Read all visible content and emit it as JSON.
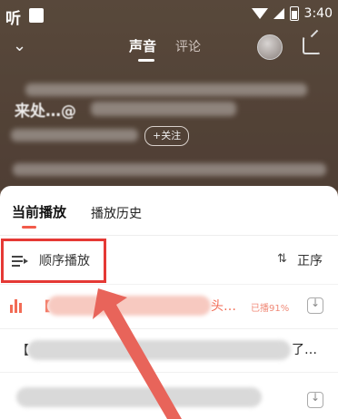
{
  "status_bar": {
    "app": "听",
    "time": "3:40"
  },
  "header": {
    "tab_sound": "声音",
    "tab_comment": "评论"
  },
  "background": {
    "line1": "来处…@",
    "follow": "+关注"
  },
  "sheet": {
    "tab_current": "当前播放",
    "tab_history": "播放历史",
    "mode_label": "顺序播放",
    "sort_label": "正序",
    "rows": [
      {
        "bracket": "【",
        "tail": "头…",
        "played": "已播91%"
      },
      {
        "bracket": "【",
        "tail": "了…"
      },
      {
        "bracket": "",
        "tail": ""
      }
    ]
  },
  "colors": {
    "accent": "#f26b55",
    "highlight": "#e53935",
    "arrow": "#e8645a"
  }
}
